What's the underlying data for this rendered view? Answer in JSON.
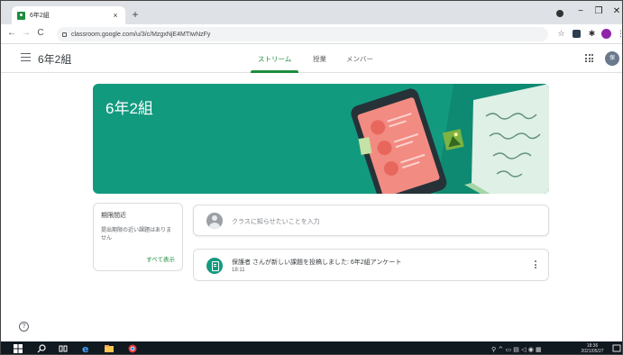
{
  "browser": {
    "tab_title": "6年2組",
    "tab_close": "×",
    "new_tab": "+",
    "url": "classroom.google.com/u/3/c/MzgxNjE4MTIwNzFy",
    "nav": {
      "back": "←",
      "forward": "→",
      "reload": "C"
    },
    "window": {
      "minimize": "−",
      "maximize": "❐",
      "close": "✕"
    }
  },
  "header": {
    "class_title": "6年2組",
    "tabs": [
      {
        "label": "ストリーム",
        "active": true
      },
      {
        "label": "授業",
        "active": false
      },
      {
        "label": "メンバー",
        "active": false
      }
    ],
    "avatar_initial": "保"
  },
  "banner": {
    "title": "6年2組",
    "color": "#129a7f"
  },
  "upcoming": {
    "title": "期限間近",
    "text": "提出期限の近い課題はありません",
    "view_all": "すべて表示"
  },
  "announce": {
    "placeholder": "クラスに知らせたいことを入力"
  },
  "posts": [
    {
      "title": "保護者 さんが新しい課題を投稿しました: 6年2組アンケート",
      "time": "18:11"
    }
  ],
  "help": {
    "glyph": "?"
  },
  "taskbar": {
    "clock_time": "18:36",
    "clock_date": "2021/05/27"
  },
  "colors": {
    "accent": "#1e8e3e",
    "theme": "#129a7f"
  }
}
